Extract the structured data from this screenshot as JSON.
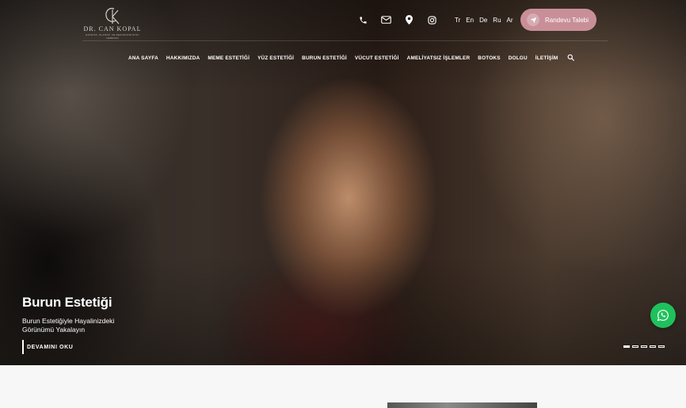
{
  "brand": {
    "name": "DR. CAN KOPAL",
    "tagline": "ESTETİK, PLASTİK VE REKONSTRÜKTİF CERRAHİ",
    "monogram": "CK"
  },
  "topbar": {
    "icons": [
      "phone-icon",
      "mail-icon",
      "location-icon",
      "instagram-icon"
    ],
    "languages": [
      "Tr",
      "En",
      "De",
      "Ru",
      "Ar"
    ],
    "appointment_label": "Randevu Talebi"
  },
  "nav": [
    "ANA SAYFA",
    "HAKKIMIZDA",
    "MEME ESTETİĞİ",
    "YÜZ ESTETİĞİ",
    "BURUN ESTETİĞİ",
    "VÜCUT ESTETİĞİ",
    "AMELİYATSIZ İŞLEMLER",
    "BOTOKS",
    "DOLGU",
    "İLETİŞİM"
  ],
  "hero": {
    "title": "Burun Estetiği",
    "subtitle": "Burun Estetiğiyle Hayalinizdeki Görünümü Yakalayın",
    "cta": "DEVAMINI OKU",
    "slides_total": 5,
    "active_slide": 1
  },
  "colors": {
    "accent": "#c98f98",
    "whatsapp": "#1fc15c"
  }
}
